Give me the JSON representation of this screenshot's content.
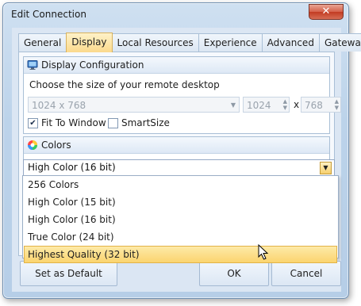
{
  "window": {
    "title": "Edit Connection",
    "close_glyph": "✕"
  },
  "tabs": [
    {
      "label": "General",
      "active": false
    },
    {
      "label": "Display",
      "active": true
    },
    {
      "label": "Local Resources",
      "active": false
    },
    {
      "label": "Experience",
      "active": false
    },
    {
      "label": "Advanced",
      "active": false
    },
    {
      "label": "Gateway",
      "active": false
    }
  ],
  "display_config": {
    "header": "Display Configuration",
    "icon": "monitor-icon",
    "prompt": "Choose the size of your remote desktop",
    "resolution_value": "1024 x 768",
    "width_value": "1024",
    "height_value": "768",
    "separator": "x",
    "fit_to_window": {
      "label": "Fit To Window",
      "checked": true
    },
    "smart_size": {
      "label": "SmartSize",
      "checked": false
    }
  },
  "colors": {
    "header": "Colors",
    "icon": "color-wheel-icon",
    "selected_value": "High Color (16 bit)",
    "options": [
      "256 Colors",
      "High Color (15 bit)",
      "High Color (16 bit)",
      "True Color (24 bit)",
      "Highest Quality (32 bit)"
    ],
    "highlighted_index": 4
  },
  "footer": {
    "set_default": "Set as Default",
    "ok": "OK",
    "cancel": "Cancel"
  },
  "accent_colors": {
    "highlight": "#fbd46f",
    "title_bar": "#bcd3ea",
    "close_button": "#c23b22"
  }
}
